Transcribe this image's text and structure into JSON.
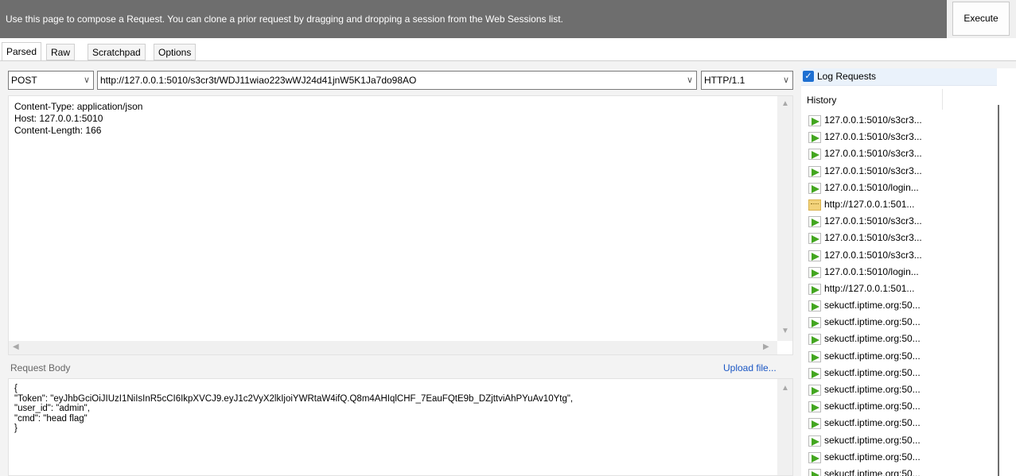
{
  "banner": {
    "text": "Use this page to compose a Request. You can clone a prior request by dragging and dropping a session from the Web Sessions list."
  },
  "toolbar": {
    "execute_label": "Execute"
  },
  "tabs": [
    {
      "label": "Parsed",
      "active": true
    },
    {
      "label": "Raw",
      "active": false
    },
    {
      "label": "Scratchpad",
      "active": false
    },
    {
      "label": "Options",
      "active": false
    }
  ],
  "request": {
    "method": "POST",
    "url": "http://127.0.0.1:5010/s3cr3t/WDJ11wiao223wWJ24d41jnW5K1Ja7do98AO",
    "protocol": "HTTP/1.1",
    "headers": "Content-Type: application/json\nHost: 127.0.0.1:5010\nContent-Length: 166",
    "body_label": "Request Body",
    "upload_label": "Upload file...",
    "body": "{\n\"Token\": \"eyJhbGciOiJIUzI1NiIsInR5cCI6IkpXVCJ9.eyJ1c2VyX2lkIjoiYWRtaW4ifQ.Q8m4AHIqlCHF_7EauFQtE9b_DZjttviAhPYuAv10Ytg\",\n\"user_id\": \"admin\",\n\"cmd\": \"head flag\"\n}"
  },
  "history": {
    "log_requests_label": "Log Requests",
    "log_requests_checked": true,
    "header": "History",
    "items": [
      {
        "label": "127.0.0.1:5010/s3cr3...",
        "icon": "green-arrow-icon"
      },
      {
        "label": "127.0.0.1:5010/s3cr3...",
        "icon": "green-arrow-icon"
      },
      {
        "label": "127.0.0.1:5010/s3cr3...",
        "icon": "green-arrow-icon"
      },
      {
        "label": "127.0.0.1:5010/s3cr3...",
        "icon": "green-arrow-icon"
      },
      {
        "label": "127.0.0.1:5010/login...",
        "icon": "green-arrow-icon"
      },
      {
        "label": "http://127.0.0.1:501...",
        "icon": "text-file-icon"
      },
      {
        "label": "127.0.0.1:5010/s3cr3...",
        "icon": "green-arrow-icon"
      },
      {
        "label": "127.0.0.1:5010/s3cr3...",
        "icon": "green-arrow-icon"
      },
      {
        "label": "127.0.0.1:5010/s3cr3...",
        "icon": "green-arrow-icon"
      },
      {
        "label": "127.0.0.1:5010/login...",
        "icon": "green-arrow-icon"
      },
      {
        "label": "http://127.0.0.1:501...",
        "icon": "green-arrow-icon"
      },
      {
        "label": "sekuctf.iptime.org:50...",
        "icon": "green-arrow-icon"
      },
      {
        "label": "sekuctf.iptime.org:50...",
        "icon": "green-arrow-icon"
      },
      {
        "label": "sekuctf.iptime.org:50...",
        "icon": "green-arrow-icon"
      },
      {
        "label": "sekuctf.iptime.org:50...",
        "icon": "green-arrow-icon"
      },
      {
        "label": "sekuctf.iptime.org:50...",
        "icon": "green-arrow-icon"
      },
      {
        "label": "sekuctf.iptime.org:50...",
        "icon": "green-arrow-icon"
      },
      {
        "label": "sekuctf.iptime.org:50...",
        "icon": "green-arrow-icon"
      },
      {
        "label": "sekuctf.iptime.org:50...",
        "icon": "green-arrow-icon"
      },
      {
        "label": "sekuctf.iptime.org:50...",
        "icon": "green-arrow-icon"
      },
      {
        "label": "sekuctf.iptime.org:50...",
        "icon": "green-arrow-icon"
      },
      {
        "label": "sekuctf.iptime.org:50...",
        "icon": "green-arrow-icon"
      }
    ]
  },
  "colors": {
    "banner_bg": "#6e6e6e",
    "link": "#1a56c4",
    "checkbox": "#1e6fd1",
    "arrow_green": "#43a620"
  }
}
